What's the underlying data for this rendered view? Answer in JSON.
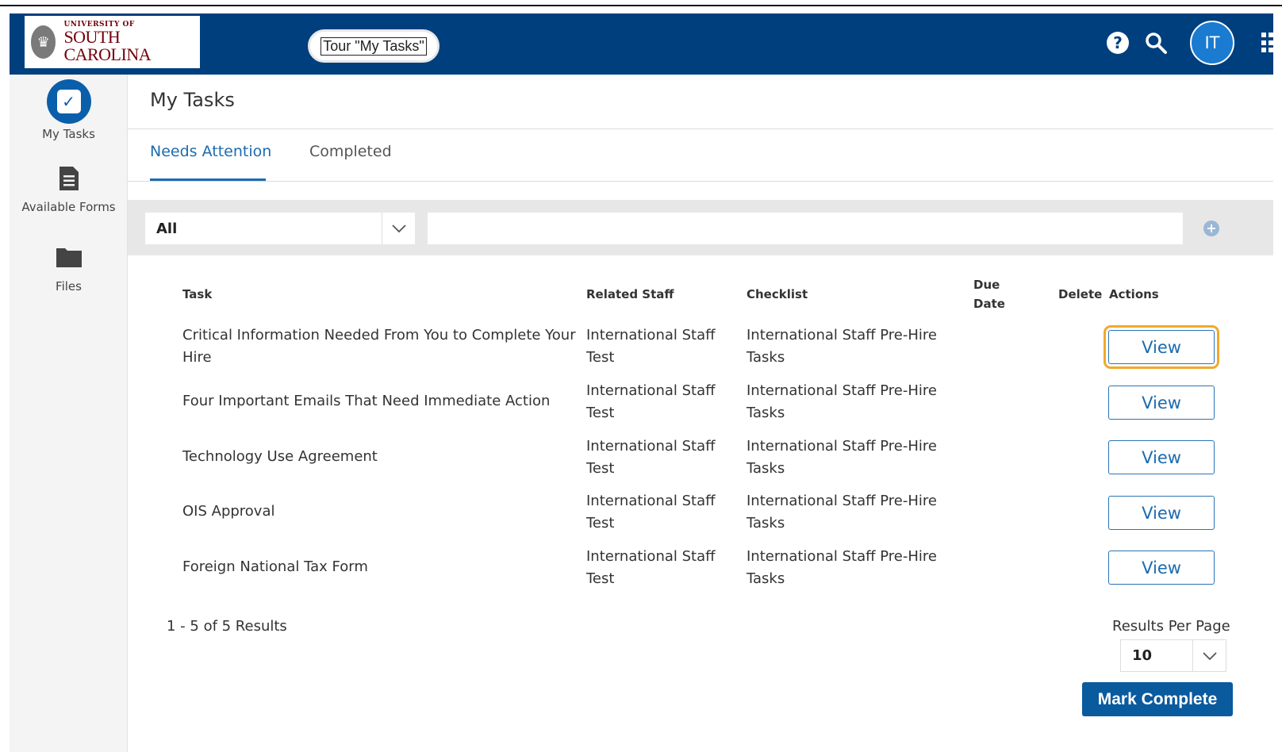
{
  "header": {
    "logo_top": "UNIVERSITY OF",
    "logo_main": "SOUTH CAROLINA",
    "tour_label": "Tour \"My Tasks\"",
    "user_initials": "IT",
    "icons": [
      "help-icon",
      "search-icon",
      "apps-grid-icon"
    ]
  },
  "sidebar": {
    "items": [
      {
        "label": "My Tasks",
        "icon": "checkbox-icon",
        "active": true
      },
      {
        "label": "Available Forms",
        "icon": "document-icon",
        "active": false
      },
      {
        "label": "Files",
        "icon": "folder-icon",
        "active": false
      }
    ]
  },
  "main": {
    "title": "My Tasks",
    "tabs": [
      {
        "label": "Needs Attention",
        "active": true
      },
      {
        "label": "Completed",
        "active": false
      }
    ],
    "filter": {
      "selected": "All",
      "search_value": ""
    },
    "table": {
      "columns": {
        "task": "Task",
        "related_staff": "Related Staff",
        "checklist": "Checklist",
        "due_date_1": "Due",
        "due_date_2": "Date",
        "delete": "Delete",
        "actions": "Actions"
      },
      "rows": [
        {
          "task_1": "Critical Information Needed From You to Complete Your",
          "task_2": "Hire",
          "staff_1": "International Staff",
          "staff_2": "Test",
          "checklist_1": "International Staff Pre-Hire",
          "checklist_2": "Tasks",
          "action": "View"
        },
        {
          "task_1": "Four Important Emails That Need Immediate Action",
          "task_2": "",
          "staff_1": "International Staff",
          "staff_2": "Test",
          "checklist_1": "International Staff Pre-Hire",
          "checklist_2": "Tasks",
          "action": "View"
        },
        {
          "task_1": "Technology Use Agreement",
          "task_2": "",
          "staff_1": "International Staff",
          "staff_2": "Test",
          "checklist_1": "International Staff Pre-Hire",
          "checklist_2": "Tasks",
          "action": "View"
        },
        {
          "task_1": "OIS Approval",
          "task_2": "",
          "staff_1": "International Staff",
          "staff_2": "Test",
          "checklist_1": "International Staff Pre-Hire",
          "checklist_2": "Tasks",
          "action": "View"
        },
        {
          "task_1": "Foreign National Tax Form",
          "task_2": "",
          "staff_1": "International Staff",
          "staff_2": "Test",
          "checklist_1": "International Staff Pre-Hire",
          "checklist_2": "Tasks",
          "action": "View"
        }
      ]
    },
    "results_count": "1 - 5 of 5 Results",
    "results_per_page_label": "Results Per Page",
    "results_per_page_value": "10",
    "mark_complete_label": "Mark Complete"
  },
  "colors": {
    "header_bg": "#003f7d",
    "accent": "#1c6bb0",
    "focus_outline": "#f0a92c",
    "primary_button": "#0a5a9e"
  }
}
